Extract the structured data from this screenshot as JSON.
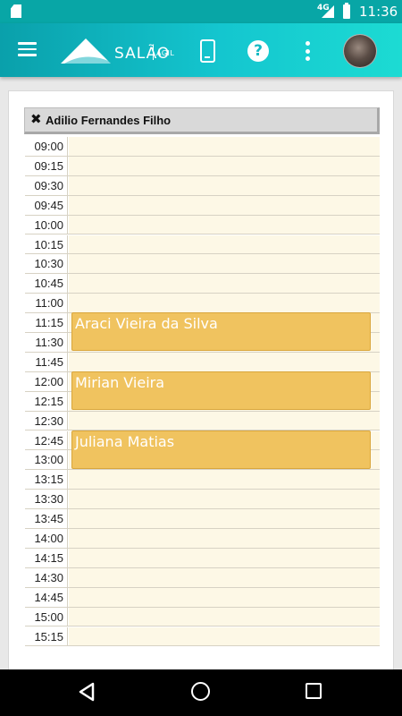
{
  "status_bar": {
    "network": "4G",
    "time": "11:36"
  },
  "app_bar": {
    "logo_text": "SALÃO",
    "logo_subtext": "ÁGIL"
  },
  "resource": {
    "name": "Adilio Fernandes Filho"
  },
  "schedule": {
    "times": [
      "09:00",
      "09:15",
      "09:30",
      "09:45",
      "10:00",
      "10:15",
      "10:30",
      "10:45",
      "11:00",
      "11:15",
      "11:30",
      "11:45",
      "12:00",
      "12:15",
      "12:30",
      "12:45",
      "13:00",
      "13:15",
      "13:30",
      "13:45",
      "14:00",
      "14:15",
      "14:30",
      "14:45",
      "15:00",
      "15:15"
    ],
    "appointments": [
      {
        "client": "Araci Vieira da Silva",
        "start": "11:15",
        "end": "11:45"
      },
      {
        "client": "Mirian Vieira",
        "start": "12:00",
        "end": "12:30"
      },
      {
        "client": "Juliana Matias",
        "start": "12:45",
        "end": "13:15"
      }
    ]
  },
  "colors": {
    "app_bar_start": "#0aa0ab",
    "app_bar_end": "#1cdbd3",
    "slot_background": "#fdf8e6",
    "appointment": "#f0c35f"
  },
  "icons": {
    "status": [
      "sd-card-icon",
      "signal-icon",
      "battery-icon"
    ],
    "app_bar": [
      "menu-icon",
      "phone-icon",
      "help-icon",
      "more-vert-icon"
    ],
    "nav": [
      "back-icon",
      "home-icon",
      "recents-icon"
    ]
  }
}
